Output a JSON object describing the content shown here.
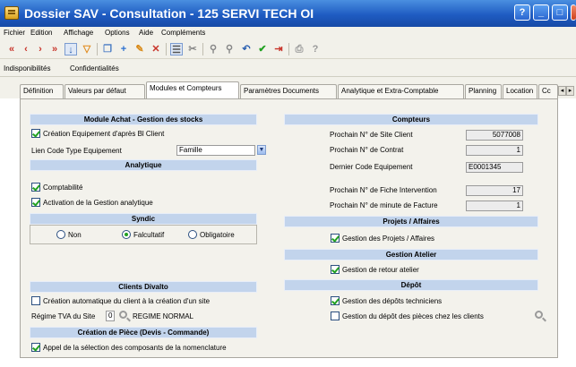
{
  "window": {
    "title": "Dossier SAV - Consultation - 125 SERVI TECH OI"
  },
  "menu": [
    "Fichier",
    "Edition",
    "Affichage",
    "Options",
    "Aide",
    "Compléments"
  ],
  "subtabs": [
    "Indisponibilités",
    "Confidentialités"
  ],
  "tabs": [
    "Définition",
    "Valeurs par défaut",
    "Modules et Compteurs",
    "Paramètres Documents",
    "Analytique et Extra-Comptable",
    "Planning",
    "Location",
    "Cc"
  ],
  "left": {
    "module_achat": {
      "header": "Module Achat - Gestion des stocks",
      "creation_equipement": "Création Equipement d'après Bl Client",
      "creation_equipement_checked": true,
      "lien_code_label": "Lien Code Type Equipement",
      "lien_code_value": "Famille"
    },
    "analytique": {
      "header": "Analytique",
      "comptabilite": "Comptabilité",
      "comptabilite_checked": true,
      "activation": "Activation de la Gestion analytique",
      "activation_checked": true
    },
    "syndic": {
      "header": "Syndic",
      "options": [
        "Non",
        "Falcultatif",
        "Obligatoire"
      ],
      "selected": "Falcultatif"
    },
    "clients": {
      "header": "Clients Divalto",
      "creation_auto": "Création automatique du client à la création d'un site",
      "creation_auto_checked": false,
      "regime_label": "Régime TVA du Site",
      "regime_code": "0",
      "regime_value": "REGIME NORMAL"
    },
    "creation_piece": {
      "header": "Création de Pièce (Devis - Commande)",
      "appel": "Appel de la sélection des composants de la nomenclature",
      "appel_checked": true
    }
  },
  "right": {
    "compteurs": {
      "header": "Compteurs",
      "rows": [
        {
          "label": "Prochain N° de Site Client",
          "value": "5077008"
        },
        {
          "label": "Prochain N° de Contrat",
          "value": "1"
        },
        {
          "label": "Dernier Code Equipement",
          "value": "E0001345"
        },
        {
          "label": "Prochain N° de Fiche Intervention",
          "value": "17"
        },
        {
          "label": "Prochain N° de minute de Facture",
          "value": "1"
        }
      ]
    },
    "projets": {
      "header": "Projets / Affaires",
      "gestion": "Gestion des Projets / Affaires",
      "gestion_checked": true
    },
    "atelier": {
      "header": "Gestion Atelier",
      "retour": "Gestion de retour atelier",
      "retour_checked": true
    },
    "depot": {
      "header": "Dépôt",
      "techniciens": "Gestion des dépôts techniciens",
      "techniciens_checked": true,
      "clients": "Gestion du dépôt des pièces chez les clients",
      "clients_checked": false
    }
  },
  "icons": {
    "toolbar": [
      "first-icon",
      "prev-icon",
      "next-icon",
      "last-icon",
      "sort-icon",
      "filter-icon",
      "copy-icon",
      "add-icon",
      "edit-icon",
      "delete-icon",
      "list-icon",
      "scissors-icon",
      "search-icon",
      "search-replace-icon",
      "undo-icon",
      "validate-icon",
      "exit-icon",
      "print-icon",
      "help-icon"
    ]
  }
}
